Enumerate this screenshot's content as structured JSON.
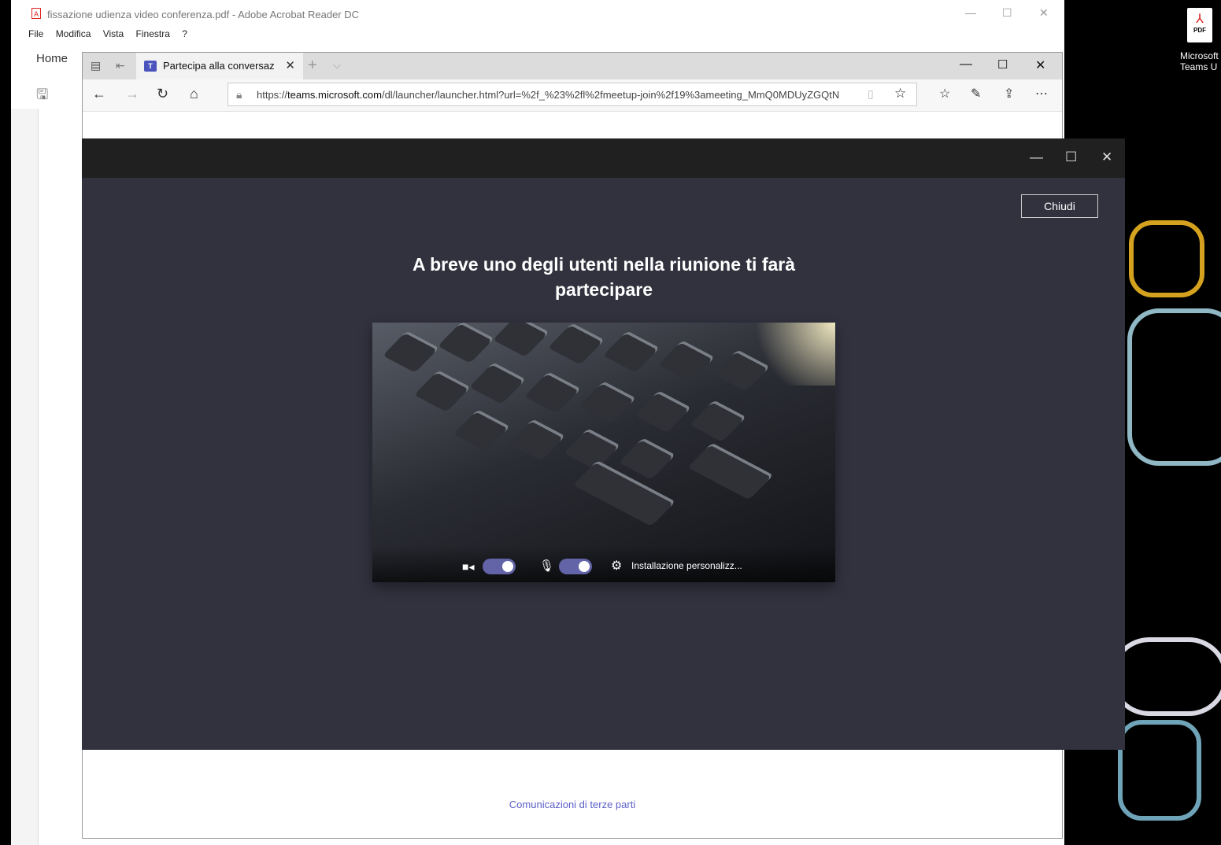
{
  "acrobat": {
    "title": "fissazione udienza video conferenza.pdf - Adobe Acrobat Reader DC",
    "menu": [
      "File",
      "Modifica",
      "Vista",
      "Finestra",
      "?"
    ],
    "home_tab": "Home",
    "pdf_icon": "pdf-icon"
  },
  "edge": {
    "tab_label": "Partecipa alla conversaz",
    "url_prefix": "https://",
    "url_domain": "teams.microsoft.com",
    "url_rest": "/dl/launcher/launcher.html?url=%2f_%23%2fl%2fmeetup-join%2f19%3ameeting_MmQ0MDUyZGQtN",
    "footer_link": "Comunicazioni di terze parti"
  },
  "teams": {
    "close_button": "Chiudi",
    "heading": "A breve uno degli utenti nella riunione ti farà partecipare",
    "settings_label": "Installazione personalizz...",
    "camera_on": true,
    "mic_on": true,
    "accent": "#6264a7"
  },
  "desktop": {
    "icon_label": "Microsoft Teams U",
    "icon_badge": "PDF"
  }
}
